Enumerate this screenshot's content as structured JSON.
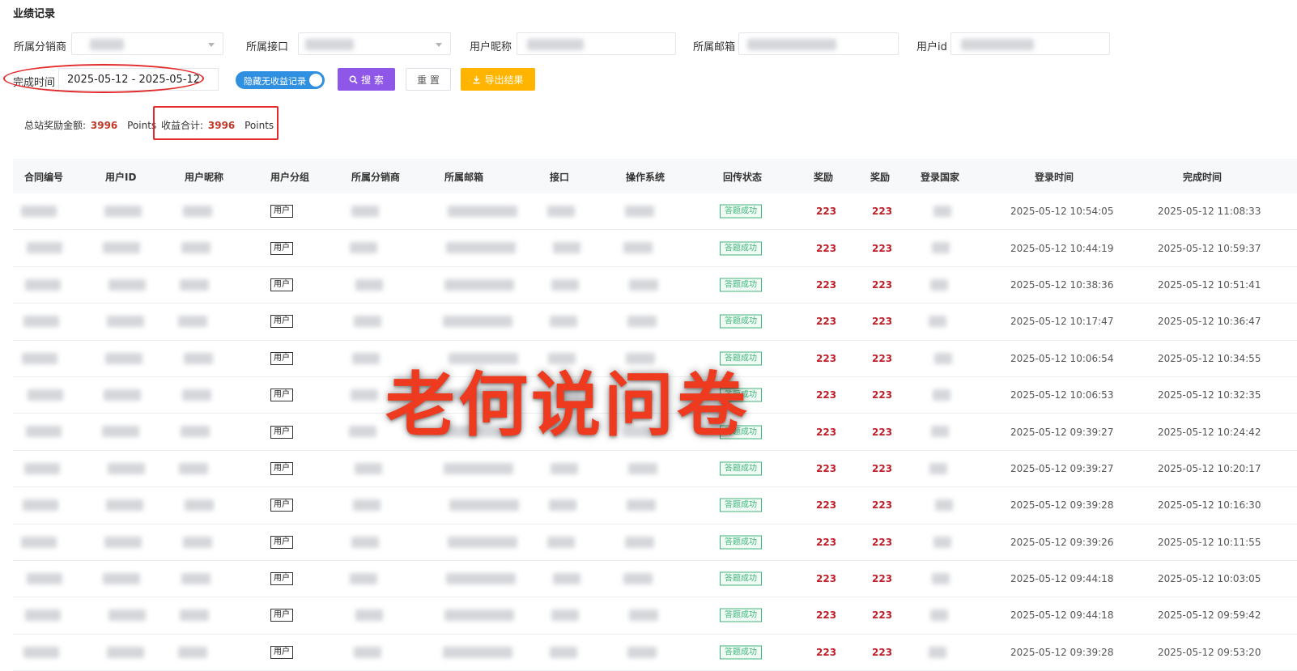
{
  "page": {
    "title": "业绩记录"
  },
  "filters": {
    "distributor_label": "所属分销商",
    "interface_label": "所属接口",
    "nickname_label": "用户昵称",
    "email_label": "所属邮箱",
    "userid_label": "用户id",
    "complete_time_label": "完成时间",
    "complete_time_value": "2025-05-12 - 2025-05-12",
    "hide_toggle_label": "隐藏无收益记录",
    "hide_toggle_on": true
  },
  "actions": {
    "search_label": "搜 索",
    "reset_label": "重 置",
    "export_label": "导出结果",
    "search_icon": "search-icon",
    "export_icon": "download-icon"
  },
  "summary": {
    "total_label": "总站奖励金额:",
    "total_value": "3996",
    "total_unit": "Points",
    "income_label": "收益合计:",
    "income_value": "3996",
    "income_unit": "Points"
  },
  "table": {
    "headers": [
      "合同编号",
      "用户ID",
      "用户昵称",
      "用户分组",
      "所属分销商",
      "所属邮箱",
      "接口",
      "操作系统",
      "回传状态",
      "奖励",
      "奖励",
      "登录国家",
      "登录时间",
      "完成时间"
    ],
    "rows": [
      {
        "group": "用户",
        "status": "答题成功",
        "reward1": "223",
        "reward2": "223",
        "login": "2025-05-12 10:54:05",
        "done": "2025-05-12 11:08:33"
      },
      {
        "group": "用户",
        "status": "答题成功",
        "reward1": "223",
        "reward2": "223",
        "login": "2025-05-12 10:44:19",
        "done": "2025-05-12 10:59:37"
      },
      {
        "group": "用户",
        "status": "答题成功",
        "reward1": "223",
        "reward2": "223",
        "login": "2025-05-12 10:38:36",
        "done": "2025-05-12 10:51:41"
      },
      {
        "group": "用户",
        "status": "答题成功",
        "reward1": "223",
        "reward2": "223",
        "login": "2025-05-12 10:17:47",
        "done": "2025-05-12 10:36:47"
      },
      {
        "group": "用户",
        "status": "答题成功",
        "reward1": "223",
        "reward2": "223",
        "login": "2025-05-12 10:06:54",
        "done": "2025-05-12 10:34:55"
      },
      {
        "group": "用户",
        "status": "答题成功",
        "reward1": "223",
        "reward2": "223",
        "login": "2025-05-12 10:06:53",
        "done": "2025-05-12 10:32:35"
      },
      {
        "group": "用户",
        "status": "答题成功",
        "reward1": "223",
        "reward2": "223",
        "login": "2025-05-12 09:39:27",
        "done": "2025-05-12 10:24:42"
      },
      {
        "group": "用户",
        "status": "答题成功",
        "reward1": "223",
        "reward2": "223",
        "login": "2025-05-12 09:39:27",
        "done": "2025-05-12 10:20:17"
      },
      {
        "group": "用户",
        "status": "答题成功",
        "reward1": "223",
        "reward2": "223",
        "login": "2025-05-12 09:39:28",
        "done": "2025-05-12 10:16:30"
      },
      {
        "group": "用户",
        "status": "答题成功",
        "reward1": "223",
        "reward2": "223",
        "login": "2025-05-12 09:39:26",
        "done": "2025-05-12 10:11:55"
      },
      {
        "group": "用户",
        "status": "答题成功",
        "reward1": "223",
        "reward2": "223",
        "login": "2025-05-12 09:44:18",
        "done": "2025-05-12 10:03:05"
      },
      {
        "group": "用户",
        "status": "答题成功",
        "reward1": "223",
        "reward2": "223",
        "login": "2025-05-12 09:44:18",
        "done": "2025-05-12 09:59:42"
      },
      {
        "group": "用户",
        "status": "答题成功",
        "reward1": "223",
        "reward2": "223",
        "login": "2025-05-12 09:39:28",
        "done": "2025-05-12 09:53:20"
      }
    ]
  },
  "overlay": {
    "watermark_text": "老何说问卷"
  },
  "colors": {
    "search_btn": "#8f57e8",
    "export_btn": "#ffb400",
    "toggle": "#2f8fe0",
    "reward": "#c0202a",
    "status": "#3fb67a",
    "annotation": "#e22a2a"
  }
}
